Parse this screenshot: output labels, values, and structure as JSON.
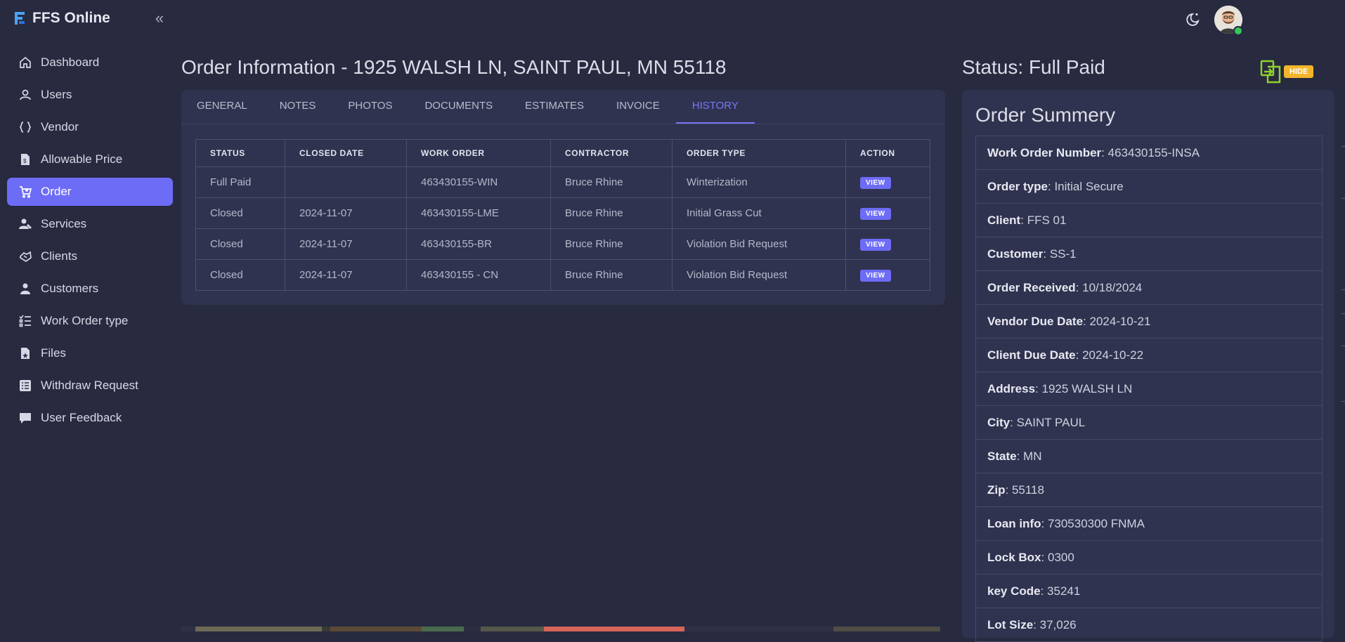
{
  "app": {
    "name": "FFS Online"
  },
  "sidebar": {
    "items": [
      {
        "label": "Dashboard",
        "icon": "home-icon",
        "active": false
      },
      {
        "label": "Users",
        "icon": "user-icon",
        "active": false
      },
      {
        "label": "Vendor",
        "icon": "braces-icon",
        "active": false
      },
      {
        "label": "Allowable Price",
        "icon": "price-file-icon",
        "active": false
      },
      {
        "label": "Order",
        "icon": "cart-icon",
        "active": true
      },
      {
        "label": "Services",
        "icon": "services-icon",
        "active": false
      },
      {
        "label": "Clients",
        "icon": "clients-icon",
        "active": false
      },
      {
        "label": "Customers",
        "icon": "customers-icon",
        "active": false
      },
      {
        "label": "Work Order type",
        "icon": "list-icon",
        "active": false
      },
      {
        "label": "Files",
        "icon": "file-icon",
        "active": false
      },
      {
        "label": "Withdraw Request",
        "icon": "request-icon",
        "active": false
      },
      {
        "label": "User Feedback",
        "icon": "feedback-icon",
        "active": false
      }
    ]
  },
  "main": {
    "title": "Order Information - 1925 WALSH LN, SAINT PAUL, MN 55118",
    "tabs": [
      "GENERAL",
      "NOTES",
      "PHOTOS",
      "DOCUMENTS",
      "ESTIMATES",
      "INVOICE",
      "HISTORY"
    ],
    "active_tab": "HISTORY",
    "history": {
      "columns": [
        "STATUS",
        "CLOSED DATE",
        "WORK ORDER",
        "CONTRACTOR",
        "ORDER TYPE",
        "ACTION"
      ],
      "rows": [
        [
          "Full Paid",
          "",
          "463430155-WIN",
          "Bruce Rhine",
          "Winterization",
          "VIEW"
        ],
        [
          "Closed",
          "2024-11-07",
          "463430155-LME",
          "Bruce Rhine",
          "Initial Grass Cut",
          "VIEW"
        ],
        [
          "Closed",
          "2024-11-07",
          "463430155-BR",
          "Bruce Rhine",
          "Violation Bid Request",
          "VIEW"
        ],
        [
          "Closed",
          "2024-11-07",
          "463430155 - CN",
          "Bruce Rhine",
          "Violation Bid Request",
          "VIEW"
        ]
      ]
    }
  },
  "right": {
    "status": "Status: Full Paid",
    "hide_label": "HIDE",
    "summary_title": "Order Summery",
    "summary": [
      {
        "label": "Work Order Number",
        "value": "463430155-INSA"
      },
      {
        "label": "Order type",
        "value": "Initial Secure"
      },
      {
        "label": "Client",
        "value": "FFS 01"
      },
      {
        "label": "Customer",
        "value": "SS-1"
      },
      {
        "label": "Order Received",
        "value": "10/18/2024"
      },
      {
        "label": "Vendor Due Date",
        "value": "2024-10-21"
      },
      {
        "label": "Client Due Date",
        "value": "2024-10-22"
      },
      {
        "label": "Address",
        "value": "1925 WALSH LN"
      },
      {
        "label": "City",
        "value": "SAINT PAUL"
      },
      {
        "label": "State",
        "value": "MN"
      },
      {
        "label": "Zip",
        "value": "55118"
      },
      {
        "label": "Loan info",
        "value": "730530300 FNMA"
      },
      {
        "label": "Lock Box",
        "value": "0300"
      },
      {
        "label": "key Code",
        "value": "35241"
      },
      {
        "label": "Lot Size",
        "value": "37,026"
      }
    ]
  },
  "colors": {
    "background": "#282a40",
    "card": "#30334f",
    "accent": "#6d6cf7",
    "hide_button": "#f2b52c",
    "hide_icon": "#8fd42a",
    "online": "#35c759"
  }
}
